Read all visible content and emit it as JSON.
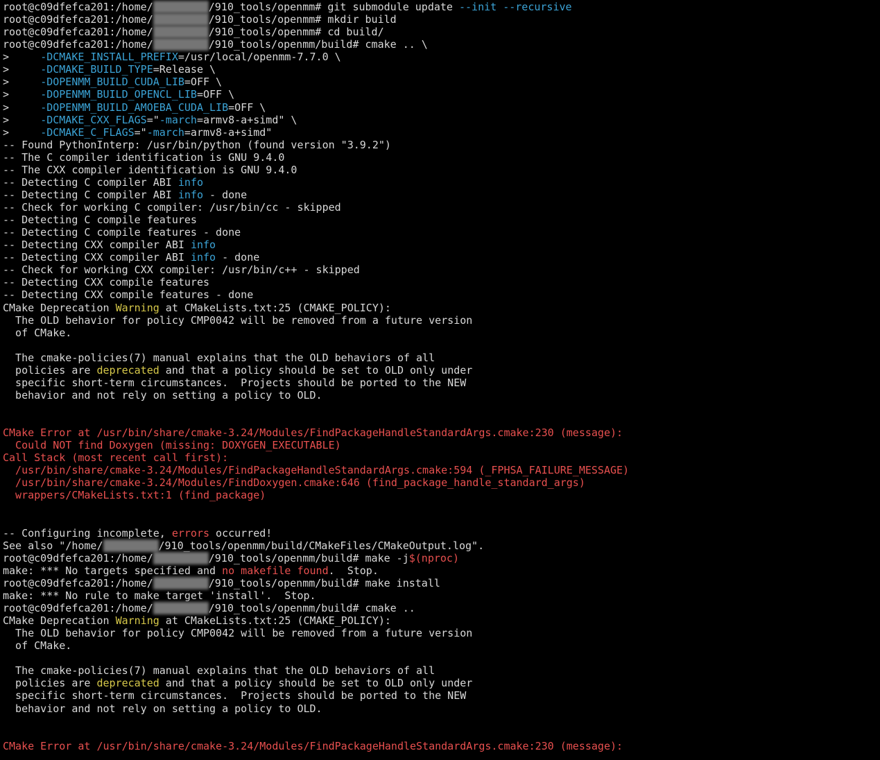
{
  "terminal": {
    "lines": [
      {
        "segs": [
          {
            "t": "root@c09dfefca201:/home/",
            "c": "default"
          },
          {
            "t": "",
            "c": "redacted",
            "w": 80
          },
          {
            "t": "/910_tools/openmm# git submodule update ",
            "c": "default"
          },
          {
            "t": "--init --recursive",
            "c": "blue"
          }
        ]
      },
      {
        "segs": [
          {
            "t": "root@c09dfefca201:/home/",
            "c": "default"
          },
          {
            "t": "",
            "c": "redacted",
            "w": 80
          },
          {
            "t": "/910_tools/openmm# mkdir build",
            "c": "default"
          }
        ]
      },
      {
        "segs": [
          {
            "t": "root@c09dfefca201:/home/",
            "c": "default"
          },
          {
            "t": "",
            "c": "redacted",
            "w": 80
          },
          {
            "t": "/910_tools/openmm# cd build/",
            "c": "default"
          }
        ]
      },
      {
        "segs": [
          {
            "t": "root@c09dfefca201:/home/",
            "c": "default"
          },
          {
            "t": "",
            "c": "redacted",
            "w": 80
          },
          {
            "t": "/910_tools/openmm/build# cmake .. \\",
            "c": "default"
          }
        ]
      },
      {
        "segs": [
          {
            "t": ">     ",
            "c": "default"
          },
          {
            "t": "-DCMAKE_INSTALL_PREFIX",
            "c": "blue"
          },
          {
            "t": "=/usr/local/openmm-7.7.0 \\",
            "c": "default"
          }
        ]
      },
      {
        "segs": [
          {
            "t": ">     ",
            "c": "default"
          },
          {
            "t": "-DCMAKE_BUILD_TYPE",
            "c": "blue"
          },
          {
            "t": "=Release \\",
            "c": "default"
          }
        ]
      },
      {
        "segs": [
          {
            "t": ">     ",
            "c": "default"
          },
          {
            "t": "-DOPENMM_BUILD_CUDA_LIB",
            "c": "blue"
          },
          {
            "t": "=OFF \\",
            "c": "default"
          }
        ]
      },
      {
        "segs": [
          {
            "t": ">     ",
            "c": "default"
          },
          {
            "t": "-DOPENMM_BUILD_OPENCL_LIB",
            "c": "blue"
          },
          {
            "t": "=OFF \\",
            "c": "default"
          }
        ]
      },
      {
        "segs": [
          {
            "t": ">     ",
            "c": "default"
          },
          {
            "t": "-DOPENMM_BUILD_AMOEBA_CUDA_LIB",
            "c": "blue"
          },
          {
            "t": "=OFF \\",
            "c": "default"
          }
        ]
      },
      {
        "segs": [
          {
            "t": ">     ",
            "c": "default"
          },
          {
            "t": "-DCMAKE_CXX_FLAGS",
            "c": "blue"
          },
          {
            "t": "=\"",
            "c": "default"
          },
          {
            "t": "-march",
            "c": "blue"
          },
          {
            "t": "=armv8-a+simd\" \\",
            "c": "default"
          }
        ]
      },
      {
        "segs": [
          {
            "t": ">     ",
            "c": "default"
          },
          {
            "t": "-DCMAKE_C_FLAGS",
            "c": "blue"
          },
          {
            "t": "=\"",
            "c": "default"
          },
          {
            "t": "-march",
            "c": "blue"
          },
          {
            "t": "=armv8-a+simd\"",
            "c": "default"
          }
        ]
      },
      {
        "segs": [
          {
            "t": "-- Found PythonInterp: /usr/bin/python (found version \"3.9.2\")",
            "c": "default"
          }
        ]
      },
      {
        "segs": [
          {
            "t": "-- The C compiler identification is GNU 9.4.0",
            "c": "default"
          }
        ]
      },
      {
        "segs": [
          {
            "t": "-- The CXX compiler identification is GNU 9.4.0",
            "c": "default"
          }
        ]
      },
      {
        "segs": [
          {
            "t": "-- Detecting C compiler ABI ",
            "c": "default"
          },
          {
            "t": "info",
            "c": "blue"
          }
        ]
      },
      {
        "segs": [
          {
            "t": "-- Detecting C compiler ABI ",
            "c": "default"
          },
          {
            "t": "info",
            "c": "blue"
          },
          {
            "t": " - done",
            "c": "default"
          }
        ]
      },
      {
        "segs": [
          {
            "t": "-- Check for working C compiler: /usr/bin/cc - skipped",
            "c": "default"
          }
        ]
      },
      {
        "segs": [
          {
            "t": "-- Detecting C compile features",
            "c": "default"
          }
        ]
      },
      {
        "segs": [
          {
            "t": "-- Detecting C compile features - done",
            "c": "default"
          }
        ]
      },
      {
        "segs": [
          {
            "t": "-- Detecting CXX compiler ABI ",
            "c": "default"
          },
          {
            "t": "info",
            "c": "blue"
          }
        ]
      },
      {
        "segs": [
          {
            "t": "-- Detecting CXX compiler ABI ",
            "c": "default"
          },
          {
            "t": "info",
            "c": "blue"
          },
          {
            "t": " - done",
            "c": "default"
          }
        ]
      },
      {
        "segs": [
          {
            "t": "-- Check for working CXX compiler: /usr/bin/c++ - skipped",
            "c": "default"
          }
        ]
      },
      {
        "segs": [
          {
            "t": "-- Detecting CXX compile features",
            "c": "default"
          }
        ]
      },
      {
        "segs": [
          {
            "t": "-- Detecting CXX compile features - done",
            "c": "default"
          }
        ]
      },
      {
        "segs": [
          {
            "t": "CMake Deprecation ",
            "c": "default"
          },
          {
            "t": "Warning",
            "c": "yellow"
          },
          {
            "t": " at CMakeLists.txt:25 (CMAKE_POLICY):",
            "c": "default"
          }
        ]
      },
      {
        "segs": [
          {
            "t": "  The OLD behavior for policy CMP0042 will be removed from a future version",
            "c": "default"
          }
        ]
      },
      {
        "segs": [
          {
            "t": "  of CMake.",
            "c": "default"
          }
        ]
      },
      {
        "segs": []
      },
      {
        "segs": [
          {
            "t": "  The cmake-policies(7) manual explains that the OLD behaviors of all",
            "c": "default"
          }
        ]
      },
      {
        "segs": [
          {
            "t": "  policies are ",
            "c": "default"
          },
          {
            "t": "deprecated",
            "c": "yellow"
          },
          {
            "t": " and that a policy should be set to OLD only under",
            "c": "default"
          }
        ]
      },
      {
        "segs": [
          {
            "t": "  specific short-term circumstances.  Projects should be ported to the NEW",
            "c": "default"
          }
        ]
      },
      {
        "segs": [
          {
            "t": "  behavior and not rely on setting a policy to OLD.",
            "c": "default"
          }
        ]
      },
      {
        "segs": []
      },
      {
        "segs": []
      },
      {
        "segs": [
          {
            "t": "CMake Error at /usr/bin/share/cmake-3.24/Modules/FindPackageHandleStandardArgs.cmake:230 (message):",
            "c": "red"
          }
        ]
      },
      {
        "segs": [
          {
            "t": "  Could NOT find Doxygen (missing: DOXYGEN_EXECUTABLE)",
            "c": "red"
          }
        ]
      },
      {
        "segs": [
          {
            "t": "Call Stack (most recent call first):",
            "c": "red"
          }
        ]
      },
      {
        "segs": [
          {
            "t": "  /usr/bin/share/cmake-3.24/Modules/FindPackageHandleStandardArgs.cmake:594 (_FPHSA_FAILURE_MESSAGE)",
            "c": "red"
          }
        ]
      },
      {
        "segs": [
          {
            "t": "  /usr/bin/share/cmake-3.24/Modules/FindDoxygen.cmake:646 (find_package_handle_standard_args)",
            "c": "red"
          }
        ]
      },
      {
        "segs": [
          {
            "t": "  wrappers/CMakeLists.txt:1 (find_package)",
            "c": "red"
          }
        ]
      },
      {
        "segs": []
      },
      {
        "segs": []
      },
      {
        "segs": [
          {
            "t": "-- Configuring incomplete, ",
            "c": "default"
          },
          {
            "t": "errors",
            "c": "red"
          },
          {
            "t": " occurred!",
            "c": "default"
          }
        ]
      },
      {
        "segs": [
          {
            "t": "See also \"/home/",
            "c": "default"
          },
          {
            "t": "",
            "c": "redacted",
            "w": 80
          },
          {
            "t": "/910_tools/openmm/build/CMakeFiles/CMakeOutput.log\".",
            "c": "default"
          }
        ]
      },
      {
        "segs": [
          {
            "t": "root@c09dfefca201:/home/",
            "c": "default"
          },
          {
            "t": "",
            "c": "redacted",
            "w": 80
          },
          {
            "t": "/910_tools/openmm/build# make -j",
            "c": "default"
          },
          {
            "t": "$(nproc)",
            "c": "red"
          }
        ]
      },
      {
        "segs": [
          {
            "t": "make: *** No targets specified and ",
            "c": "default"
          },
          {
            "t": "no makefile found",
            "c": "red"
          },
          {
            "t": ".  Stop.",
            "c": "default"
          }
        ]
      },
      {
        "segs": [
          {
            "t": "root@c09dfefca201:/home/",
            "c": "default"
          },
          {
            "t": "",
            "c": "redacted",
            "w": 80
          },
          {
            "t": "/910_tools/openmm/build# make install",
            "c": "default"
          }
        ]
      },
      {
        "segs": [
          {
            "t": "make: *** No rule to make target 'install'.  Stop.",
            "c": "default"
          }
        ]
      },
      {
        "segs": [
          {
            "t": "root@c09dfefca201:/home/",
            "c": "default"
          },
          {
            "t": "",
            "c": "redacted",
            "w": 80
          },
          {
            "t": "/910_tools/openmm/build# cmake ..",
            "c": "default"
          }
        ]
      },
      {
        "segs": [
          {
            "t": "CMake Deprecation ",
            "c": "default"
          },
          {
            "t": "Warning",
            "c": "yellow"
          },
          {
            "t": " at CMakeLists.txt:25 (CMAKE_POLICY):",
            "c": "default"
          }
        ]
      },
      {
        "segs": [
          {
            "t": "  The OLD behavior for policy CMP0042 will be removed from a future version",
            "c": "default"
          }
        ]
      },
      {
        "segs": [
          {
            "t": "  of CMake.",
            "c": "default"
          }
        ]
      },
      {
        "segs": []
      },
      {
        "segs": [
          {
            "t": "  The cmake-policies(7) manual explains that the OLD behaviors of all",
            "c": "default"
          }
        ]
      },
      {
        "segs": [
          {
            "t": "  policies are ",
            "c": "default"
          },
          {
            "t": "deprecated",
            "c": "yellow"
          },
          {
            "t": " and that a policy should be set to OLD only under",
            "c": "default"
          }
        ]
      },
      {
        "segs": [
          {
            "t": "  specific short-term circumstances.  Projects should be ported to the NEW",
            "c": "default"
          }
        ]
      },
      {
        "segs": [
          {
            "t": "  behavior and not rely on setting a policy to OLD.",
            "c": "default"
          }
        ]
      },
      {
        "segs": []
      },
      {
        "segs": []
      },
      {
        "segs": [
          {
            "t": "CMake Error at /usr/bin/share/cmake-3.24/Modules/FindPackageHandleStandardArgs.cmake:230 (message):",
            "c": "red"
          }
        ]
      }
    ]
  }
}
